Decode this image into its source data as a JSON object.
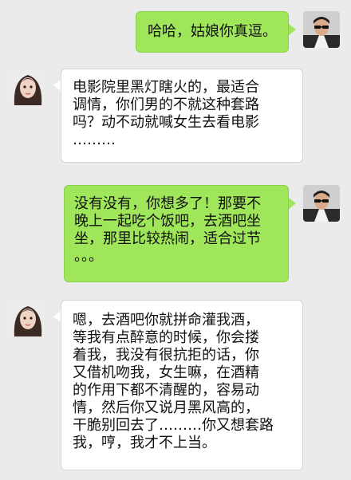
{
  "colors": {
    "background": "#ebebeb",
    "sent_bubble": "#9fe65a",
    "received_bubble": "#ffffff"
  },
  "messages": [
    {
      "side": "right",
      "avatar": "man-in-sunglasses-avatar",
      "lines": [
        "哈哈，姑娘你真逗。"
      ]
    },
    {
      "side": "left",
      "avatar": "young-woman-avatar",
      "lines": [
        "电影院里黑灯瞎火的，最适合",
        "调情，你们男的不就这种套路",
        "吗？动不动就喊女生去看电影",
        "………"
      ]
    },
    {
      "side": "right",
      "avatar": "man-in-sunglasses-avatar",
      "lines": [
        "没有没有，你想多了！那要不",
        "晚上一起吃个饭吧，去酒吧坐",
        "坐，那里比较热闹，适合过节",
        "。。。"
      ]
    },
    {
      "side": "left",
      "avatar": "young-woman-avatar",
      "lines": [
        "嗯，去酒吧你就拼命灌我酒，",
        "等我有点醉意的时候，你会搂",
        "着我，我没有很抗拒的话，你",
        "又借机吻我，女生嘛，在酒精",
        "的作用下都不清醒的，容易动",
        "情，然后你又说月黑风高的，",
        "干脆别回去了………你又想套路",
        "我，哼，我才不上当。"
      ]
    }
  ]
}
